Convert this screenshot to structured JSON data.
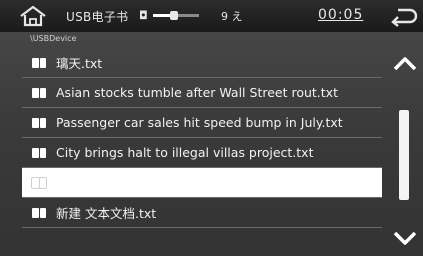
{
  "status_bar": {
    "title": "USB电子书",
    "track_info": "9 え",
    "clock": "00:05",
    "volume_level": 0.45
  },
  "path": "\\USBDevice",
  "files": [
    {
      "name": "璃天.txt",
      "icon": "file-icon"
    },
    {
      "name": "Asian stocks tumble after Wall Street rout.txt",
      "icon": "file-icon"
    },
    {
      "name": "Passenger car sales hit speed bump in July.txt",
      "icon": "file-icon"
    },
    {
      "name": "City brings halt to illegal villas project.txt",
      "icon": "file-icon"
    },
    {
      "name": "",
      "icon": "file-icon",
      "selected": true
    },
    {
      "name": "新建 文本文档.txt",
      "icon": "file-icon"
    }
  ],
  "icons": {
    "home": "home-icon",
    "volume": "volume-icon",
    "back": "back-arrow-icon",
    "scroll_up": "chevron-up-icon",
    "scroll_down": "chevron-down-icon"
  },
  "scroll": {
    "position": 0.0,
    "visible_fraction": 0.75
  }
}
